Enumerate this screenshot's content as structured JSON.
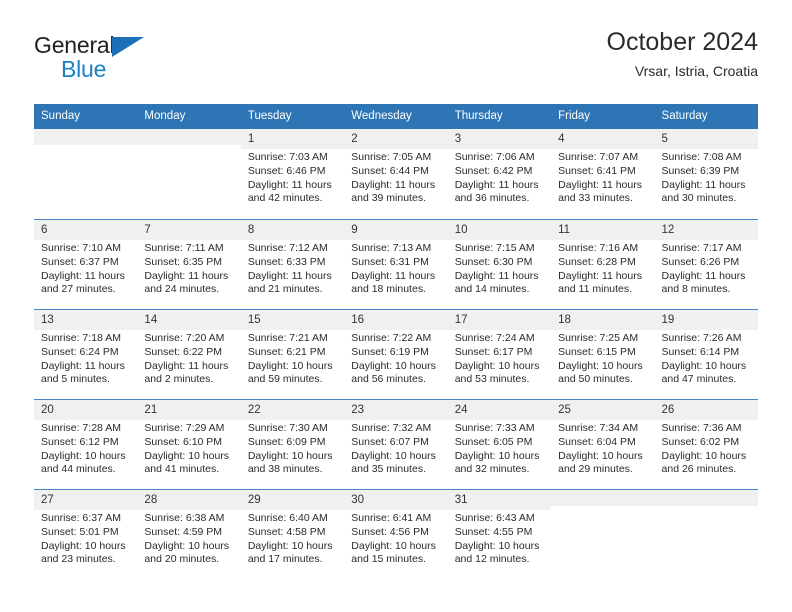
{
  "logo": {
    "word_one": "General",
    "word_two": "Blue",
    "triangle_color": "#1d6fb8",
    "blue_color": "#1d80c4"
  },
  "header": {
    "title": "October 2024",
    "subtitle": "Vrsar, Istria, Croatia"
  },
  "theme": {
    "header_blue": "#2e75b6",
    "row_separator": "#4a86c5",
    "day_number_band": "#f0f0f0"
  },
  "weekdays": [
    "Sunday",
    "Monday",
    "Tuesday",
    "Wednesday",
    "Thursday",
    "Friday",
    "Saturday"
  ],
  "weeks": [
    [
      {
        "day": "",
        "sunrise": "",
        "sunset": "",
        "daylight": "",
        "empty": true
      },
      {
        "day": "",
        "sunrise": "",
        "sunset": "",
        "daylight": "",
        "empty": true
      },
      {
        "day": "1",
        "sunrise": "Sunrise: 7:03 AM",
        "sunset": "Sunset: 6:46 PM",
        "daylight": "Daylight: 11 hours and 42 minutes."
      },
      {
        "day": "2",
        "sunrise": "Sunrise: 7:05 AM",
        "sunset": "Sunset: 6:44 PM",
        "daylight": "Daylight: 11 hours and 39 minutes."
      },
      {
        "day": "3",
        "sunrise": "Sunrise: 7:06 AM",
        "sunset": "Sunset: 6:42 PM",
        "daylight": "Daylight: 11 hours and 36 minutes."
      },
      {
        "day": "4",
        "sunrise": "Sunrise: 7:07 AM",
        "sunset": "Sunset: 6:41 PM",
        "daylight": "Daylight: 11 hours and 33 minutes."
      },
      {
        "day": "5",
        "sunrise": "Sunrise: 7:08 AM",
        "sunset": "Sunset: 6:39 PM",
        "daylight": "Daylight: 11 hours and 30 minutes."
      }
    ],
    [
      {
        "day": "6",
        "sunrise": "Sunrise: 7:10 AM",
        "sunset": "Sunset: 6:37 PM",
        "daylight": "Daylight: 11 hours and 27 minutes."
      },
      {
        "day": "7",
        "sunrise": "Sunrise: 7:11 AM",
        "sunset": "Sunset: 6:35 PM",
        "daylight": "Daylight: 11 hours and 24 minutes."
      },
      {
        "day": "8",
        "sunrise": "Sunrise: 7:12 AM",
        "sunset": "Sunset: 6:33 PM",
        "daylight": "Daylight: 11 hours and 21 minutes."
      },
      {
        "day": "9",
        "sunrise": "Sunrise: 7:13 AM",
        "sunset": "Sunset: 6:31 PM",
        "daylight": "Daylight: 11 hours and 18 minutes."
      },
      {
        "day": "10",
        "sunrise": "Sunrise: 7:15 AM",
        "sunset": "Sunset: 6:30 PM",
        "daylight": "Daylight: 11 hours and 14 minutes."
      },
      {
        "day": "11",
        "sunrise": "Sunrise: 7:16 AM",
        "sunset": "Sunset: 6:28 PM",
        "daylight": "Daylight: 11 hours and 11 minutes."
      },
      {
        "day": "12",
        "sunrise": "Sunrise: 7:17 AM",
        "sunset": "Sunset: 6:26 PM",
        "daylight": "Daylight: 11 hours and 8 minutes."
      }
    ],
    [
      {
        "day": "13",
        "sunrise": "Sunrise: 7:18 AM",
        "sunset": "Sunset: 6:24 PM",
        "daylight": "Daylight: 11 hours and 5 minutes."
      },
      {
        "day": "14",
        "sunrise": "Sunrise: 7:20 AM",
        "sunset": "Sunset: 6:22 PM",
        "daylight": "Daylight: 11 hours and 2 minutes."
      },
      {
        "day": "15",
        "sunrise": "Sunrise: 7:21 AM",
        "sunset": "Sunset: 6:21 PM",
        "daylight": "Daylight: 10 hours and 59 minutes."
      },
      {
        "day": "16",
        "sunrise": "Sunrise: 7:22 AM",
        "sunset": "Sunset: 6:19 PM",
        "daylight": "Daylight: 10 hours and 56 minutes."
      },
      {
        "day": "17",
        "sunrise": "Sunrise: 7:24 AM",
        "sunset": "Sunset: 6:17 PM",
        "daylight": "Daylight: 10 hours and 53 minutes."
      },
      {
        "day": "18",
        "sunrise": "Sunrise: 7:25 AM",
        "sunset": "Sunset: 6:15 PM",
        "daylight": "Daylight: 10 hours and 50 minutes."
      },
      {
        "day": "19",
        "sunrise": "Sunrise: 7:26 AM",
        "sunset": "Sunset: 6:14 PM",
        "daylight": "Daylight: 10 hours and 47 minutes."
      }
    ],
    [
      {
        "day": "20",
        "sunrise": "Sunrise: 7:28 AM",
        "sunset": "Sunset: 6:12 PM",
        "daylight": "Daylight: 10 hours and 44 minutes."
      },
      {
        "day": "21",
        "sunrise": "Sunrise: 7:29 AM",
        "sunset": "Sunset: 6:10 PM",
        "daylight": "Daylight: 10 hours and 41 minutes."
      },
      {
        "day": "22",
        "sunrise": "Sunrise: 7:30 AM",
        "sunset": "Sunset: 6:09 PM",
        "daylight": "Daylight: 10 hours and 38 minutes."
      },
      {
        "day": "23",
        "sunrise": "Sunrise: 7:32 AM",
        "sunset": "Sunset: 6:07 PM",
        "daylight": "Daylight: 10 hours and 35 minutes."
      },
      {
        "day": "24",
        "sunrise": "Sunrise: 7:33 AM",
        "sunset": "Sunset: 6:05 PM",
        "daylight": "Daylight: 10 hours and 32 minutes."
      },
      {
        "day": "25",
        "sunrise": "Sunrise: 7:34 AM",
        "sunset": "Sunset: 6:04 PM",
        "daylight": "Daylight: 10 hours and 29 minutes."
      },
      {
        "day": "26",
        "sunrise": "Sunrise: 7:36 AM",
        "sunset": "Sunset: 6:02 PM",
        "daylight": "Daylight: 10 hours and 26 minutes."
      }
    ],
    [
      {
        "day": "27",
        "sunrise": "Sunrise: 6:37 AM",
        "sunset": "Sunset: 5:01 PM",
        "daylight": "Daylight: 10 hours and 23 minutes."
      },
      {
        "day": "28",
        "sunrise": "Sunrise: 6:38 AM",
        "sunset": "Sunset: 4:59 PM",
        "daylight": "Daylight: 10 hours and 20 minutes."
      },
      {
        "day": "29",
        "sunrise": "Sunrise: 6:40 AM",
        "sunset": "Sunset: 4:58 PM",
        "daylight": "Daylight: 10 hours and 17 minutes."
      },
      {
        "day": "30",
        "sunrise": "Sunrise: 6:41 AM",
        "sunset": "Sunset: 4:56 PM",
        "daylight": "Daylight: 10 hours and 15 minutes."
      },
      {
        "day": "31",
        "sunrise": "Sunrise: 6:43 AM",
        "sunset": "Sunset: 4:55 PM",
        "daylight": "Daylight: 10 hours and 12 minutes."
      },
      {
        "day": "",
        "sunrise": "",
        "sunset": "",
        "daylight": "",
        "empty": true
      },
      {
        "day": "",
        "sunrise": "",
        "sunset": "",
        "daylight": "",
        "empty": true
      }
    ]
  ]
}
